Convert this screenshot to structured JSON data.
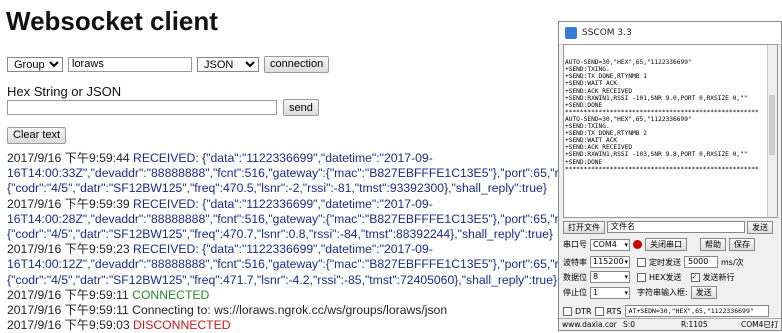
{
  "ws": {
    "title": "Websocket client",
    "group_select": "Group",
    "group_name_value": "loraws",
    "format_select": "JSON",
    "connection_button": "connection",
    "hex_label": "Hex String or JSON",
    "hex_input_value": "",
    "send_button": "send",
    "clear_button": "Clear text"
  },
  "log": [
    {
      "ts": "2017/9/16 下午9:59:44",
      "kind": "recv",
      "text": " RECEIVED: {\"data\":\"1122336699\",\"datetime\":\"2017-09-"
    },
    {
      "ts": "",
      "kind": "recv",
      "text": "16T14:00:33Z\",\"devaddr\":\"88888888\",\"fcnt\":516,\"gateway\":{\"mac\":\"B827EBFFFE1C13E5\"},\"port\":65,\"rxq"
    },
    {
      "ts": "",
      "kind": "recv",
      "text": "{\"codr\":\"4/5\",\"datr\":\"SF12BW125\",\"freq\":470.5,\"lsnr\":-2,\"rssi\":-81,\"tmst\":93392300},\"shall_reply\":true}"
    },
    {
      "ts": "2017/9/16 下午9:59:39",
      "kind": "recv",
      "text": " RECEIVED: {\"data\":\"1122336699\",\"datetime\":\"2017-09-"
    },
    {
      "ts": "",
      "kind": "recv",
      "text": "16T14:00:28Z\",\"devaddr\":\"88888888\",\"fcnt\":516,\"gateway\":{\"mac\":\"B827EBFFFE1C13E5\"},\"port\":65,\"rxq"
    },
    {
      "ts": "",
      "kind": "recv",
      "text": "{\"codr\":\"4/5\",\"datr\":\"SF12BW125\",\"freq\":470.7,\"lsnr\":0.8,\"rssi\":-84,\"tmst\":88392244},\"shall_reply\":true}"
    },
    {
      "ts": "2017/9/16 下午9:59:23",
      "kind": "recv",
      "text": " RECEIVED: {\"data\":\"1122336699\",\"datetime\":\"2017-09-"
    },
    {
      "ts": "",
      "kind": "recv",
      "text": "16T14:00:12Z\",\"devaddr\":\"88888888\",\"fcnt\":516,\"gateway\":{\"mac\":\"B827EBFFFE1C13E5\"},\"port\":65,\"rxq"
    },
    {
      "ts": "",
      "kind": "recv",
      "text": "{\"codr\":\"4/5\",\"datr\":\"SF12BW125\",\"freq\":471.7,\"lsnr\":-4.2,\"rssi\":-85,\"tmst\":72405060},\"shall_reply\":true}"
    },
    {
      "ts": "2017/9/16 下午9:59:11",
      "kind": "conn",
      "text": " CONNECTED"
    },
    {
      "ts": "2017/9/16 下午9:59:11",
      "kind": "plain",
      "text": " Connecting to: ws://loraws.ngrok.cc/ws/groups/loraws/json"
    },
    {
      "ts": "2017/9/16 下午9:59:03",
      "kind": "disc",
      "text": " DISCONNECTED"
    }
  ],
  "sscom": {
    "title": "SSCOM 3.3",
    "terminal": "AUTO-SEND=30,\"HEX\",65,\"1122336699\"\n+SEND:TXING.\n+SEND:TX DONE,RTYNMB 1\n+SEND:WAIT ACK\n+SEND:ACK RECEIVED\n+SEND:RXWIN1,RSSI -101,SNR 9.0,PORT 0,RXSIZE 0,\"\"\n+SEND:DONE\n****************************************************\nAUTO-SEND=30,\"HEX\",65,\"1122336699\"\n+SEND:TXING.\n+SEND:TX DONE,RTYNMB 2\n+SEND:WAIT ACK\n+SEND:ACK RECEIVED\n+SEND:RXWIN1,RSSI -103,SNR 9.8,PORT 0,RXSIZE 0,\"\"\n+SEND:DONE\n****************************************************",
    "open_file_button": "打开文件",
    "file_name_label": "文件名",
    "send_file_partial": "发送",
    "port_label": "串口号",
    "port_value": "COM4",
    "close_port_button": "关闭串口",
    "help_button": "帮助",
    "save_partial": "保存",
    "baud_label": "波特率",
    "baud_value": "115200",
    "timed_send_label": "定时发送",
    "interval_value": "5000",
    "interval_unit": "ms/次",
    "databits_label": "数据位",
    "databits_value": "8",
    "hex_send_label": "HEX发送",
    "newline_label": "发送新行",
    "stopbits_label": "停止位",
    "stopbits_value": "1",
    "input_label": "字符串输入框:",
    "send_button": "发送",
    "dtr_label": "DTR",
    "rts_label": "RTS",
    "input_value": "AT+SEDN=30,\"HEX\",65,\"1122336699\"",
    "status_site": "www.daxia.cor",
    "status_s": "S:0",
    "status_r": "R:1105",
    "status_port": "COM4已打"
  }
}
